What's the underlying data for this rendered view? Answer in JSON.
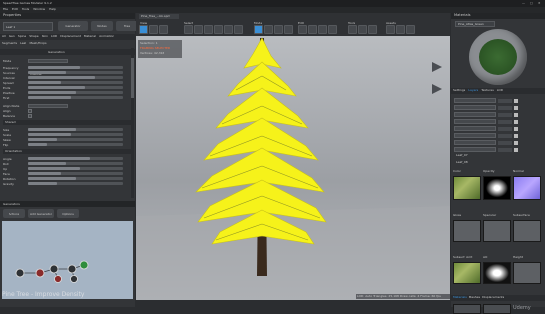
{
  "app": {
    "title": "SpeedTree Games Modeler 9.1.2",
    "window_controls": [
      "—",
      "□",
      "✕"
    ]
  },
  "menu": [
    "File",
    "Edit",
    "Tools",
    "Window",
    "Help"
  ],
  "left_panel": {
    "header": "Properties",
    "selection_label": "Leaf 1",
    "buttons": [
      "Generator",
      "Nodes",
      "Tree",
      "Publish"
    ],
    "tabs": [
      "All",
      "Gen",
      "Spine",
      "Shape",
      "Skin",
      "LOD",
      "Displacement",
      "Material",
      "Animation"
    ],
    "subtabs": [
      "Segments",
      "Leaf",
      "Mesh/Props"
    ],
    "group_generation": "Generation",
    "mode_label": "Mode",
    "mode_value": "Interval",
    "interval_rows": [
      "Frequency",
      "Sources",
      "Interval",
      "Spread",
      "Ends",
      "Positive",
      "First"
    ],
    "extra_rows": [
      "Align Node",
      "Align",
      "Balance"
    ],
    "section_shared": "Shared",
    "transform_rows": [
      "Size",
      "Scale",
      "Skew",
      "Flip"
    ],
    "section_orientation": "Orientation",
    "orientation_rows": [
      "Angle",
      "Roll",
      "Up",
      "Face",
      "Rotation",
      "Gravity"
    ]
  },
  "generators": {
    "header": "Generators",
    "buttons": [
      "Actions",
      "Add Generator",
      "Options"
    ],
    "node_icons": [
      "tree",
      "trunk",
      "branch",
      "leaf",
      "frond",
      "zone"
    ]
  },
  "viewport": {
    "tab": "Pine_Tree_...bk.spm",
    "toolbar_groups": [
      "View",
      "Select",
      "Mode",
      "Edit",
      "Tools",
      "Assets"
    ],
    "overlay_info": [
      "Selection: 1",
      "FRAMING SELECTED",
      "Vertices: 42,316"
    ],
    "caption": "Pine Tree - Improve Density",
    "status": "LOD: Auto  Triangles: 25,168  Draw calls: 4  Frame: 60 fps",
    "watermark": "Udemy"
  },
  "right_panel": {
    "materials_header": "Materials",
    "material_name": "Pine_Atlas_Green",
    "tabs": [
      "Settings",
      "Layers",
      "Textures",
      "LOD"
    ],
    "layers": [
      "Leaf_01",
      "Leaf_02",
      "Leaf_03",
      "Leaf_04",
      "Leaf_05",
      "Leaf_06",
      "Leaf_07",
      "Leaf_08"
    ],
    "map_labels": [
      "Color",
      "Opacity",
      "Normal",
      "Gloss",
      "Specular",
      "Subsurface",
      "Subsurf. Amt",
      "AO",
      "Height",
      "Custom",
      "Custom"
    ],
    "footer_tabs": [
      "Materials",
      "Meshes",
      "Displacements",
      "Assets",
      "Collision"
    ]
  },
  "colors": {
    "accent": "#3a8fd6",
    "selection_yellow": "#ffff1a",
    "panel": "#333538",
    "viewport_sky": "#b9bcc0"
  }
}
